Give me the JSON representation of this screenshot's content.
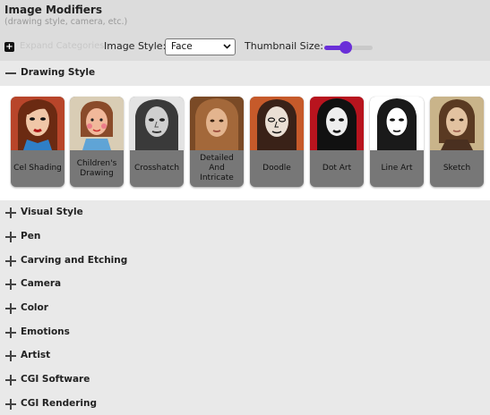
{
  "header": {
    "title": "Image Modifiers",
    "subtitle": "(drawing style, camera, etc.)"
  },
  "toolbar": {
    "expand_icon": "plus-box-icon",
    "expand_label": "Expand Categories",
    "image_style_label": "Image Style:",
    "image_style_value": "Face",
    "thumbnail_size_label": "Thumbnail Size:",
    "thumbnail_size_fraction": 0.45,
    "accent_color": "#6a2fd8"
  },
  "open_category": {
    "label": "Drawing Style",
    "icon": "minus-icon",
    "items": [
      {
        "label": "Cel Shading",
        "icon": "cel-shading-portrait"
      },
      {
        "label": "Children's Drawing",
        "icon": "childrens-drawing-portrait"
      },
      {
        "label": "Crosshatch",
        "icon": "crosshatch-portrait"
      },
      {
        "label": "Detailed And Intricate",
        "icon": "detailed-intricate-portrait"
      },
      {
        "label": "Doodle",
        "icon": "doodle-portrait"
      },
      {
        "label": "Dot Art",
        "icon": "dot-art-portrait"
      },
      {
        "label": "Line Art",
        "icon": "line-art-portrait"
      },
      {
        "label": "Sketch",
        "icon": "sketch-portrait"
      }
    ]
  },
  "collapsed_categories": [
    {
      "label": "Visual Style",
      "icon": "plus-icon"
    },
    {
      "label": "Pen",
      "icon": "plus-icon"
    },
    {
      "label": "Carving and Etching",
      "icon": "plus-icon"
    },
    {
      "label": "Camera",
      "icon": "plus-icon"
    },
    {
      "label": "Color",
      "icon": "plus-icon"
    },
    {
      "label": "Emotions",
      "icon": "plus-icon"
    },
    {
      "label": "Artist",
      "icon": "plus-icon"
    },
    {
      "label": "CGI Software",
      "icon": "plus-icon"
    },
    {
      "label": "CGI Rendering",
      "icon": "plus-icon"
    }
  ]
}
